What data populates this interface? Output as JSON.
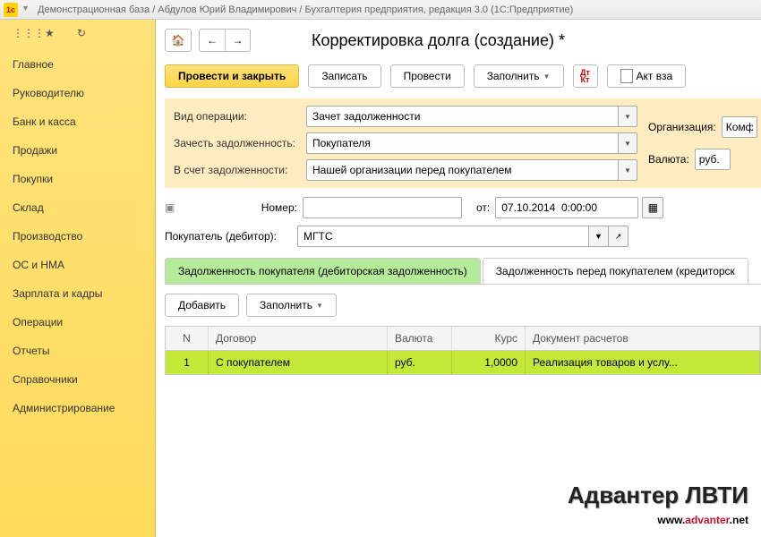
{
  "title": "Демонстрационная база / Абдулов Юрий Владимирович / Бухгалтерия предприятия, редакция 3.0  (1С:Предприятие)",
  "sidebar": {
    "items": [
      "Главное",
      "Руководителю",
      "Банк и касса",
      "Продажи",
      "Покупки",
      "Склад",
      "Производство",
      "ОС и НМА",
      "Зарплата и кадры",
      "Операции",
      "Отчеты",
      "Справочники",
      "Администрирование"
    ]
  },
  "page": {
    "title": "Корректировка долга (создание) *"
  },
  "toolbar": {
    "post_close": "Провести и закрыть",
    "save": "Записать",
    "post": "Провести",
    "fill": "Заполнить",
    "act": "Акт вза"
  },
  "form": {
    "op_label": "Вид операции:",
    "op_value": "Зачет задолженности",
    "debt_label": "Зачесть задолженность:",
    "debt_value": "Покупателя",
    "against_label": "В счет задолженности:",
    "against_value": "Нашей организации перед покупателем",
    "org_label": "Организация:",
    "org_value": "Комф",
    "cur_label": "Валюта:",
    "cur_value": "руб."
  },
  "docnum": {
    "num_label": "Номер:",
    "num_value": "",
    "from_label": "от:",
    "date_value": "07.10.2014  0:00:00"
  },
  "buyer": {
    "label": "Покупатель (дебитор):",
    "value": "МГТС"
  },
  "tabs": {
    "t1": "Задолженность покупателя (дебиторская задолженность)",
    "t2": "Задолженность перед покупателем (кредиторск"
  },
  "tabtoolbar": {
    "add": "Добавить",
    "fill": "Заполнить"
  },
  "grid": {
    "headers": {
      "n": "N",
      "contract": "Договор",
      "cur": "Валюта",
      "rate": "Курс",
      "doc": "Документ расчетов"
    },
    "row": {
      "n": "1",
      "contract": "С покупателем",
      "cur": "руб.",
      "rate": "1,0000",
      "doc": "Реализация товаров и услу..."
    }
  },
  "watermark": {
    "line1": "Адвантер ЛВТИ",
    "line2a": "www.",
    "line2b": "advanter",
    "line2c": ".net"
  }
}
